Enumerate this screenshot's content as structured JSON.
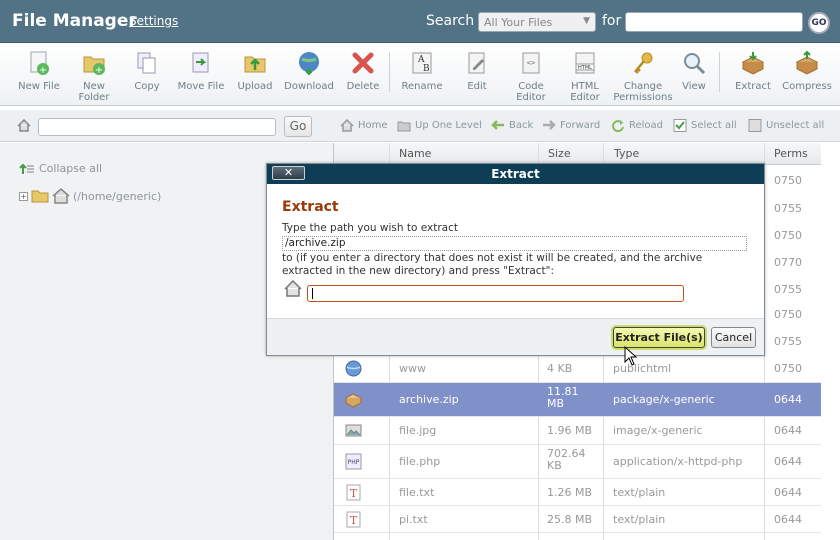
{
  "header": {
    "title": "File Manager",
    "settings_label": "Settings",
    "search_label": "Search",
    "search_scope": "All Your Files",
    "for_label": "for",
    "search_value": "",
    "go_label": "GO"
  },
  "toolbar": {
    "items": [
      {
        "label1": "New File",
        "label2": "",
        "icon": "new-file-icon"
      },
      {
        "label1": "New",
        "label2": "Folder",
        "icon": "new-folder-icon"
      },
      {
        "label1": "Copy",
        "label2": "",
        "icon": "copy-icon"
      },
      {
        "label1": "Move File",
        "label2": "",
        "icon": "move-icon"
      },
      {
        "label1": "Upload",
        "label2": "",
        "icon": "upload-icon"
      },
      {
        "label1": "Download",
        "label2": "",
        "icon": "download-icon"
      },
      {
        "label1": "Delete",
        "label2": "",
        "icon": "delete-icon"
      },
      {
        "label1": "Rename",
        "label2": "",
        "icon": "rename-icon"
      },
      {
        "label1": "Edit",
        "label2": "",
        "icon": "edit-icon"
      },
      {
        "label1": "Code",
        "label2": "Editor",
        "icon": "code-editor-icon"
      },
      {
        "label1": "HTML",
        "label2": "Editor",
        "icon": "html-editor-icon"
      },
      {
        "label1": "Change",
        "label2": "Permissions",
        "icon": "key-icon"
      },
      {
        "label1": "View",
        "label2": "",
        "icon": "view-icon"
      },
      {
        "label1": "Extract",
        "label2": "",
        "icon": "extract-icon"
      },
      {
        "label1": "Compress",
        "label2": "",
        "icon": "compress-icon"
      }
    ]
  },
  "navbar": {
    "path_value": "",
    "go_label": "Go",
    "home": "Home",
    "up": "Up One Level",
    "back": "Back",
    "forward": "Forward",
    "reload": "Reload",
    "select_all": "Select all",
    "unselect_all": "Unselect all"
  },
  "tree": {
    "collapse_all": "Collapse all",
    "root": "(/home/generic)"
  },
  "table": {
    "headers": {
      "name": "Name",
      "size": "Size",
      "type": "Type",
      "perms": "Perms"
    },
    "hidden_perms": [
      "0750",
      "0755",
      "0750",
      "0770",
      "0755",
      "0750",
      "0755"
    ],
    "rows": [
      {
        "name": "www",
        "size": "4 KB",
        "type": "publichtml",
        "perms": "0750",
        "icon": "globe-icon",
        "selected": false
      },
      {
        "name": "archive.zip",
        "size": "11.81 MB",
        "type": "package/x-generic",
        "perms": "0644",
        "icon": "package-icon",
        "selected": true
      },
      {
        "name": "file.jpg",
        "size": "1.96 MB",
        "type": "image/x-generic",
        "perms": "0644",
        "icon": "image-icon",
        "selected": false
      },
      {
        "name": "file.php",
        "size": "702.64 KB",
        "type": "application/x-httpd-php",
        "perms": "0644",
        "icon": "php-icon",
        "selected": false
      },
      {
        "name": "file.txt",
        "size": "1.26 MB",
        "type": "text/plain",
        "perms": "0644",
        "icon": "text-icon",
        "selected": false
      },
      {
        "name": "pi.txt",
        "size": "25.8 MB",
        "type": "text/plain",
        "perms": "0644",
        "icon": "text-icon",
        "selected": false
      }
    ]
  },
  "dialog": {
    "title": "Extract",
    "close_label": "✕",
    "heading": "Extract",
    "prompt": "Type the path you wish to extract",
    "source_path": "/archive.zip",
    "instructions": "to (if you enter a directory that does not exist it will be created, and the archive extracted in the new directory) and press \"Extract\":",
    "destination_value": "",
    "extract_button": "Extract File(s)",
    "cancel_button": "Cancel"
  }
}
